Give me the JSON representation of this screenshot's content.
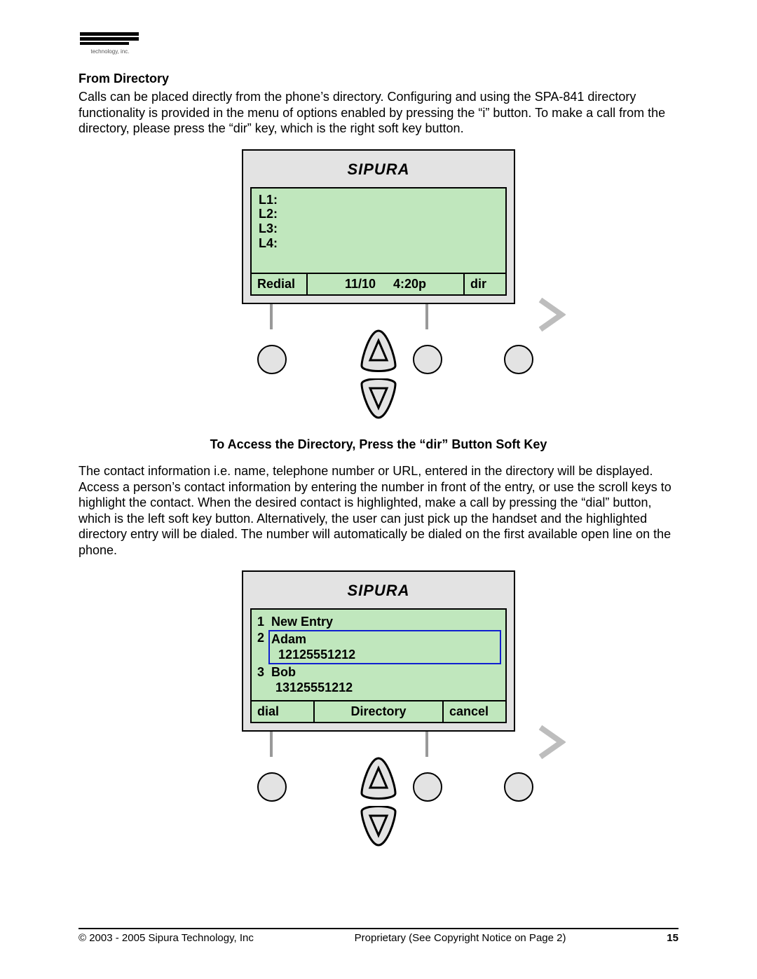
{
  "logo": {
    "company": "SIPURA",
    "tagline": "technology, inc."
  },
  "heading1": "From Directory",
  "para1": "Calls can be placed directly from the phone’s directory.   Configuring and using the SPA-841 directory functionality is provided in the menu of options enabled by pressing the “i” button.  To make a call from the directory, please press the “dir” key, which is the right soft key button.",
  "lcd_brand": "SIPURA",
  "screen1": {
    "lines": {
      "l1": "L1:",
      "l2": "L2:",
      "l3": "L3:",
      "l4": "L4:"
    },
    "soft_left": "Redial",
    "soft_mid_date": "11/10",
    "soft_mid_time": "4:20p",
    "soft_right": "dir"
  },
  "caption1": "To Access the Directory, Press the “dir” Button Soft Key",
  "para2": "The contact information i.e. name, telephone number or URL, entered in the directory will be displayed.  Access a person’s contact information by entering the number in front of the entry, or use the scroll keys to highlight the contact.  When the desired contact is highlighted, make a call by pressing the “dial” button, which is the left soft key button.  Alternatively, the user can just pick up the handset and the highlighted directory entry will be dialed.  The number will automatically be dialed on the first available open line on the phone.",
  "screen2": {
    "entries": [
      {
        "idx": "1",
        "name": "New Entry",
        "number": ""
      },
      {
        "idx": "2",
        "name": "Adam",
        "number": "12125551212"
      },
      {
        "idx": "3",
        "name": "Bob",
        "number": "13125551212"
      }
    ],
    "soft_left": "dial",
    "soft_mid": "Directory",
    "soft_right": "cancel"
  },
  "footer": {
    "left": "© 2003 - 2005 Sipura Technology, Inc",
    "center": "Proprietary (See Copyright Notice on Page 2)",
    "page": "15"
  }
}
